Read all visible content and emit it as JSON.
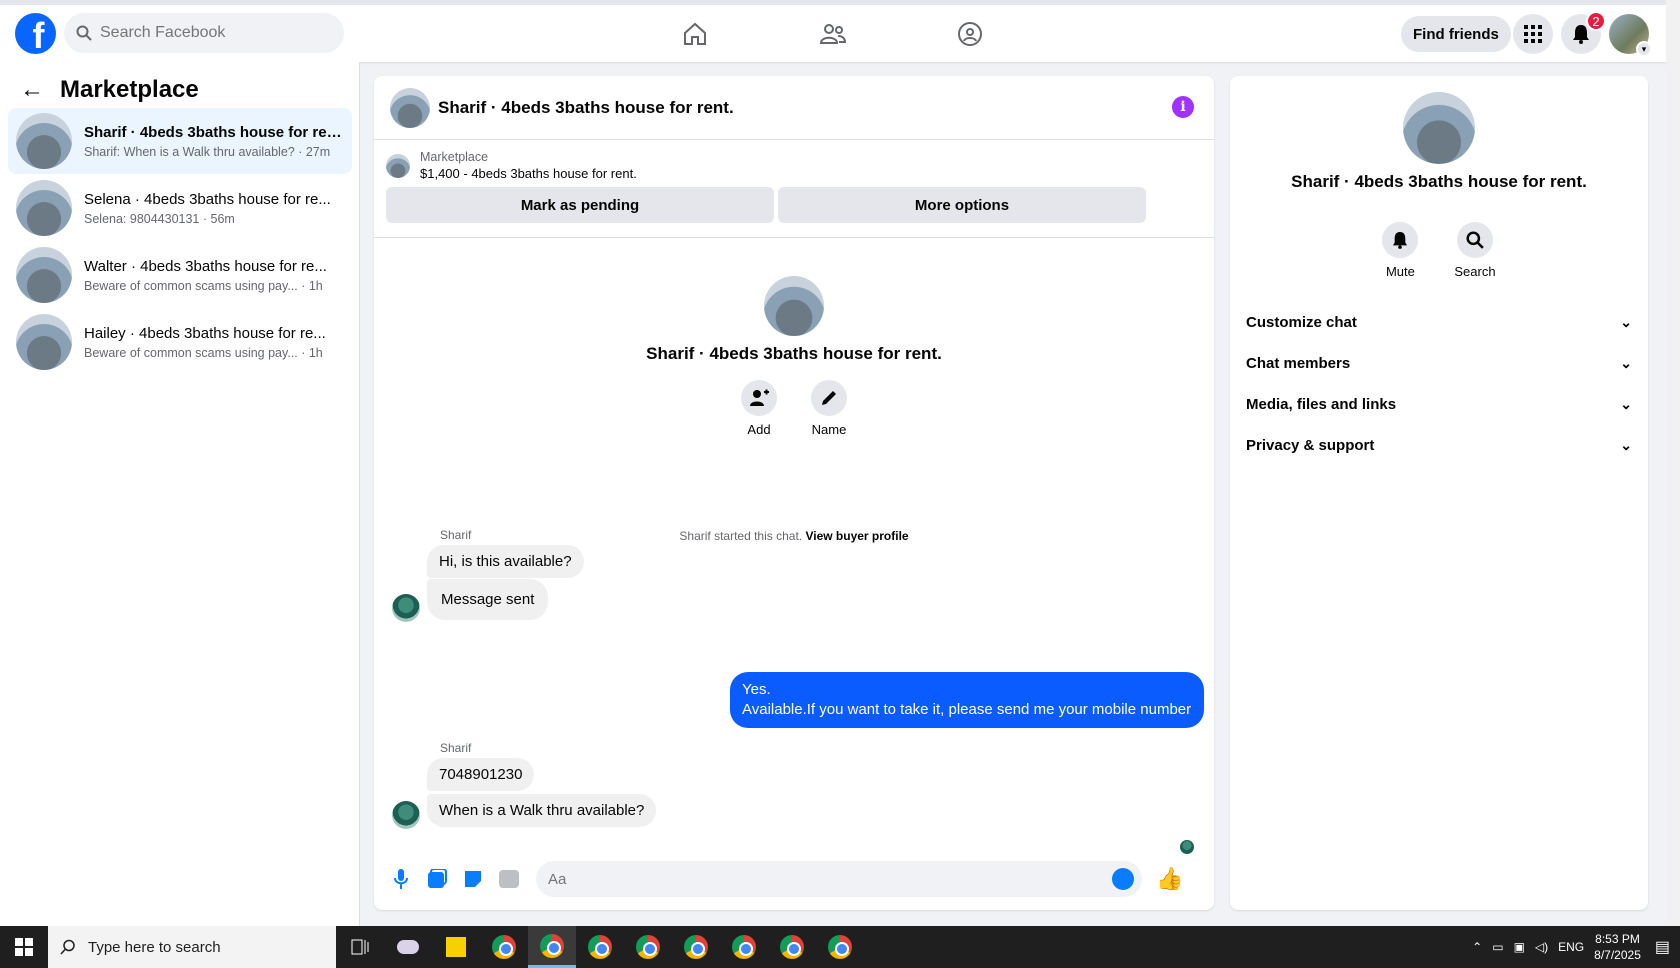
{
  "topbar": {
    "logo": "f",
    "search_placeholder": "Search Facebook",
    "find_friends": "Find friends",
    "notification_count": "2"
  },
  "sidebar": {
    "title": "Marketplace",
    "conversations": [
      {
        "title": "Sharif · 4beds 3baths house for rent.",
        "preview": "Sharif: When is a Walk thru available? · 27m"
      },
      {
        "title": "Selena · 4beds 3baths house for re...",
        "preview": "Selena: 9804430131 · 56m"
      },
      {
        "title": "Walter · 4beds 3baths house for re...",
        "preview": "Beware of common scams using pay...  · 1h"
      },
      {
        "title": "Hailey · 4beds 3baths house for re...",
        "preview": "Beware of common scams using pay...  · 1h"
      }
    ]
  },
  "chat": {
    "title": "Sharif · 4beds 3baths house for rent.",
    "marketplace_label": "Marketplace",
    "listing": "$1,400 - 4beds 3baths house for rent.",
    "mark_pending": "Mark as pending",
    "more_options": "More options",
    "profile_name": "Sharif · 4beds 3baths house for rent.",
    "add_label": "Add",
    "name_label": "Name",
    "system_note": "Sharif started this chat. ",
    "view_buyer": "View buyer profile",
    "messages": {
      "sender1": "Sharif",
      "m1": "Hi, is this available?",
      "m2": "Message sent",
      "me": "Yes.\nAvailable.If you want to take it, please send me your mobile number",
      "sender2": "Sharif",
      "m3": "7048901230",
      "m4": "When is a Walk thru available?"
    },
    "composer_placeholder": "Aa"
  },
  "rpanel": {
    "name": "Sharif · 4beds 3baths house for rent.",
    "mute": "Mute",
    "search": "Search",
    "sections": [
      "Customize chat",
      "Chat members",
      "Media, files and links",
      "Privacy & support"
    ]
  },
  "taskbar": {
    "search_placeholder": "Type here to search",
    "lang": "ENG",
    "time": "8:53 PM",
    "date": "8/7/2025"
  }
}
